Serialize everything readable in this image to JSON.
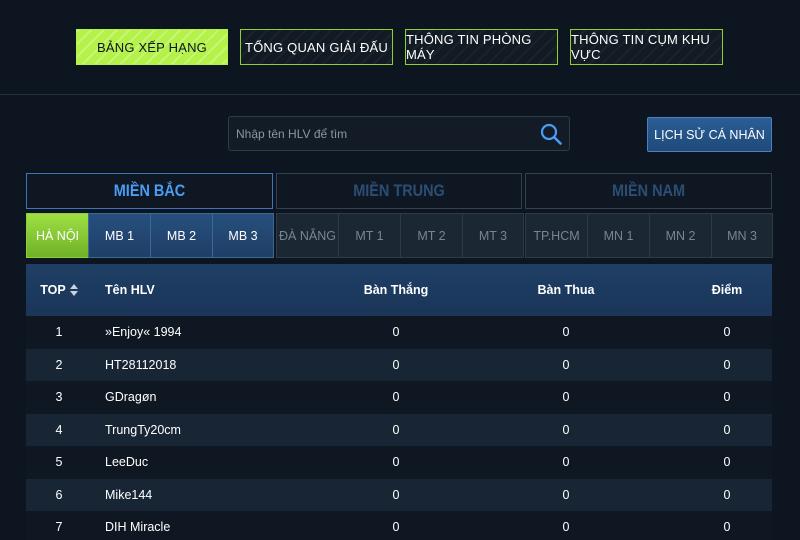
{
  "top_tabs": [
    {
      "label": "BẢNG XẾP HẠNG",
      "active": true
    },
    {
      "label": "TỔNG QUAN GIẢI ĐẤU",
      "active": false
    },
    {
      "label": "THÔNG TIN PHÒNG MÁY",
      "active": false
    },
    {
      "label": "THÔNG TIN CỤM KHU VỰC",
      "active": false
    }
  ],
  "search": {
    "placeholder": "Nhập tên HLV để tìm",
    "icon": "search-icon"
  },
  "history_button": "LỊCH SỬ CÁ NHÂN",
  "regions": [
    {
      "label": "MIỀN BẮC",
      "active": true,
      "subs": [
        "HÀ NỘI",
        "MB 1",
        "MB 2",
        "MB 3"
      ]
    },
    {
      "label": "MIỀN TRUNG",
      "active": false,
      "subs": [
        "ĐÀ NẴNG",
        "MT 1",
        "MT 2",
        "MT 3"
      ]
    },
    {
      "label": "MIỀN NAM",
      "active": false,
      "subs": [
        "TP.HCM",
        "MN 1",
        "MN 2",
        "MN 3"
      ]
    }
  ],
  "table": {
    "headers": {
      "top": "TOP",
      "name": "Tên HLV",
      "wins": "Bàn Thắng",
      "losses": "Bàn Thua",
      "points": "Điểm"
    },
    "rows": [
      {
        "top": "1",
        "name": "»Enjoy« 1994",
        "wins": "0",
        "losses": "0",
        "points": "0"
      },
      {
        "top": "2",
        "name": "HT28112018",
        "wins": "0",
        "losses": "0",
        "points": "0"
      },
      {
        "top": "3",
        "name": "GDragøn",
        "wins": "0",
        "losses": "0",
        "points": "0"
      },
      {
        "top": "4",
        "name": "TrungTy20cm",
        "wins": "0",
        "losses": "0",
        "points": "0"
      },
      {
        "top": "5",
        "name": "LeeDuc",
        "wins": "0",
        "losses": "0",
        "points": "0"
      },
      {
        "top": "6",
        "name": "Mike144",
        "wins": "0",
        "losses": "0",
        "points": "0"
      },
      {
        "top": "7",
        "name": "DIH Miracle",
        "wins": "0",
        "losses": "0",
        "points": "0"
      }
    ]
  },
  "colors": {
    "accent_green": "#b4f24a",
    "accent_blue": "#4a9cf5",
    "background": "#0d1520"
  }
}
